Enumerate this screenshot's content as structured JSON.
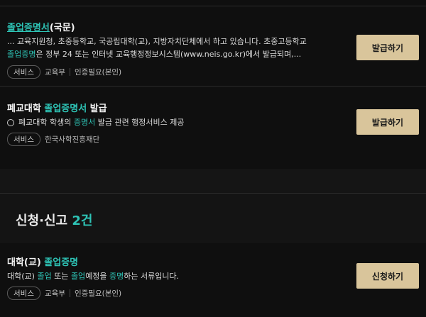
{
  "cards": [
    {
      "title_prefix": "",
      "title_highlight": "졸업증명서",
      "title_suffix": "(국문)",
      "desc_line1": "... 교육지원청, 초중등학교, 국공립대학(교), 지방자치단체에서 하고 있습니다. 초중고등학교",
      "desc_line2_highlight": "졸업증명",
      "desc_line2_rest": "은 정부 24 또는 인터넷 교육행정정보시스템(www.neis.go.kr)에서 발급되며,...",
      "tag": "서비스",
      "agency": "교육부",
      "extra": "인증필요(본인)",
      "button": "발급하기"
    },
    {
      "title_prefix": "폐교대학 ",
      "title_highlight": "졸업증명서",
      "title_suffix": " 발급",
      "desc_pre": "폐교대학 학생의 ",
      "desc_highlight": "증명서",
      "desc_post": " 발급 관련 행정서비스 제공",
      "tag": "서비스",
      "agency": "한국사학진흥재단",
      "button": "발급하기"
    }
  ],
  "section": {
    "title": "신청·신고",
    "count": "2건"
  },
  "card3": {
    "title_prefix": "대학(교) ",
    "title_highlight": "졸업증명",
    "desc_a": "대학(교) ",
    "desc_hl1": "졸업",
    "desc_b": " 또는 ",
    "desc_hl2": "졸업",
    "desc_c": "예정을 ",
    "desc_hl3": "증명",
    "desc_d": "하는 서류입니다.",
    "tag": "서비스",
    "agency": "교육부",
    "extra": "인증필요(본인)",
    "button": "신청하기"
  },
  "colors": {
    "background": "#0f0f0f",
    "highlight": "#2ec4b6",
    "button": "#d9c59b"
  }
}
